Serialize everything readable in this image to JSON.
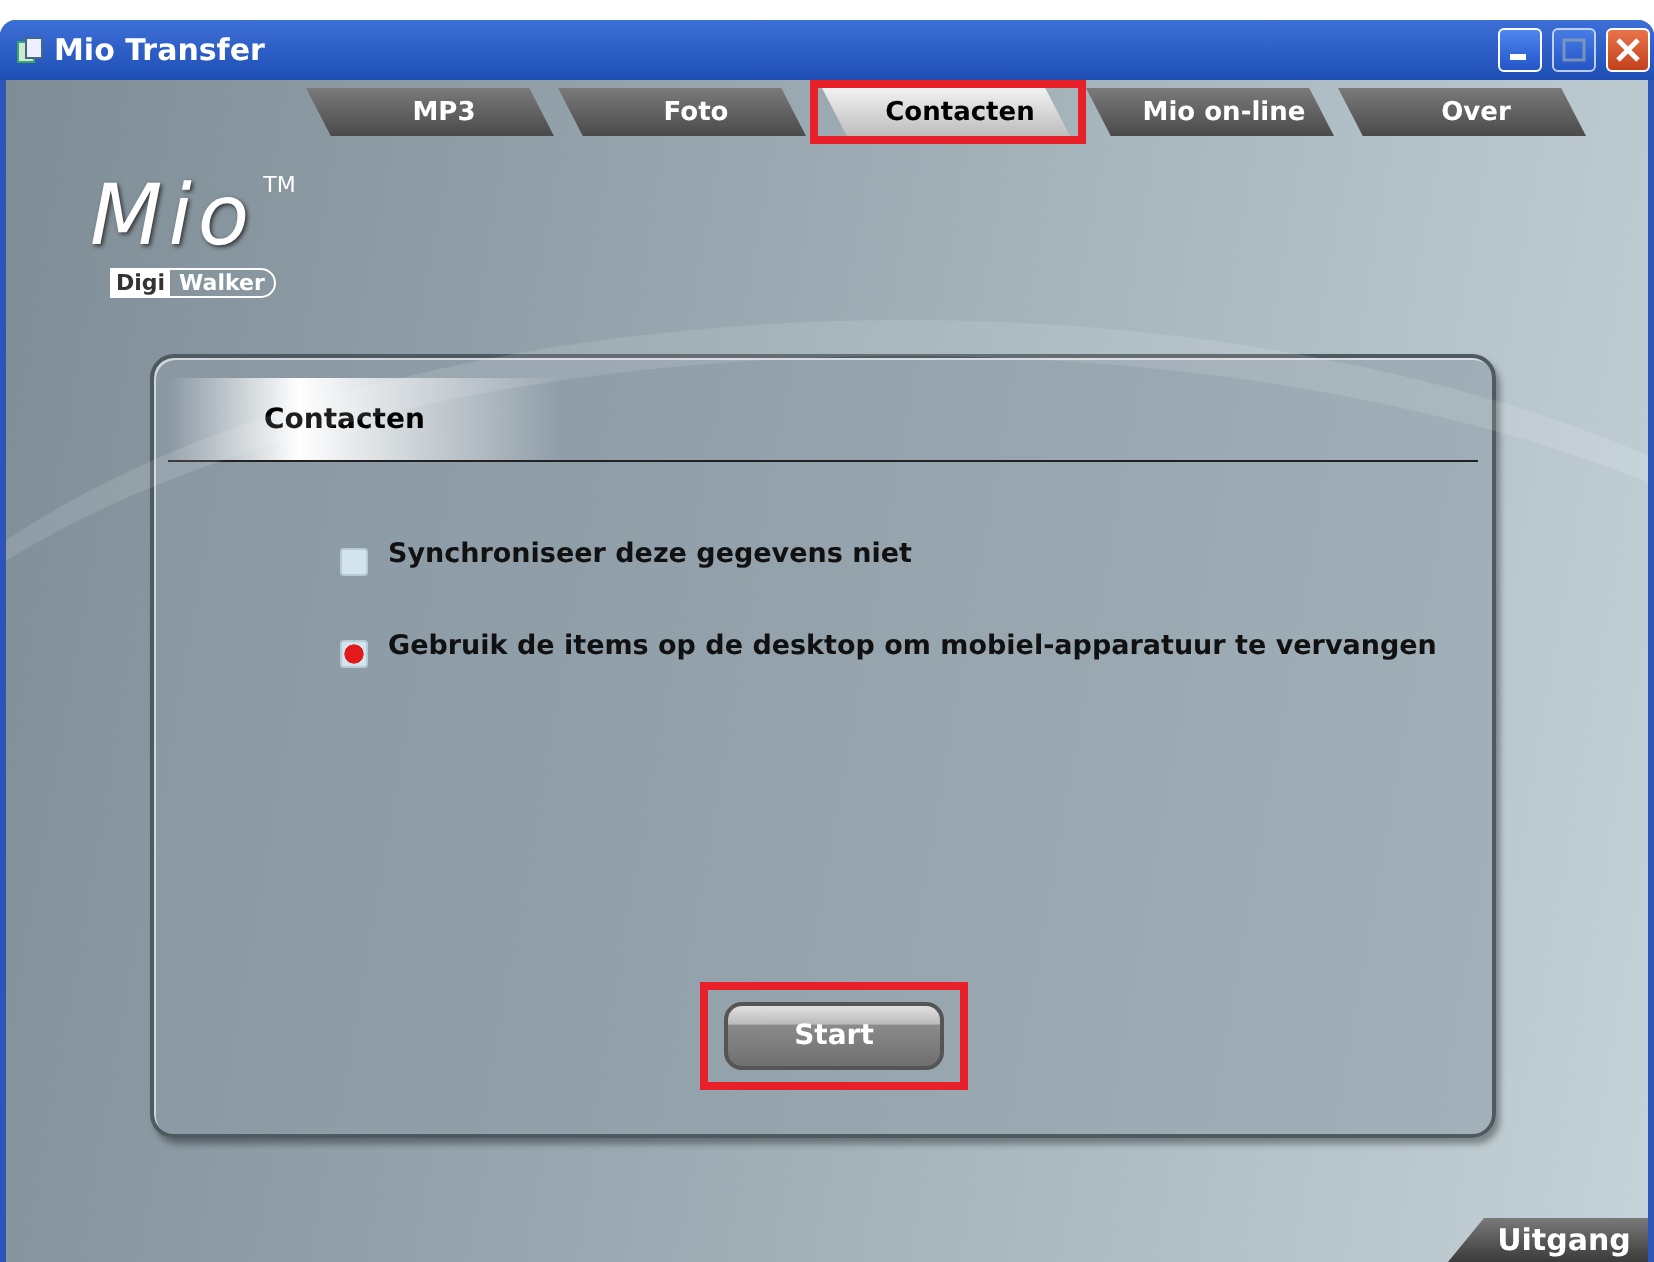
{
  "window": {
    "title": "Mio Transfer"
  },
  "tabs": [
    {
      "label": "MP3",
      "selected": false,
      "highlighted": false
    },
    {
      "label": "Foto",
      "selected": false,
      "highlighted": false
    },
    {
      "label": "Contacten",
      "selected": true,
      "highlighted": true
    },
    {
      "label": "Mio on-line",
      "selected": false,
      "highlighted": false
    },
    {
      "label": "Over",
      "selected": false,
      "highlighted": false
    }
  ],
  "logo": {
    "name": "Mio",
    "trademark": "TM",
    "badge_left": "Digi",
    "badge_right": "Walker"
  },
  "panel": {
    "title": "Contacten",
    "options": [
      {
        "label": "Synchroniseer deze gegevens niet",
        "checked": false
      },
      {
        "label": "Gebruik de items op de desktop om mobiel-apparatuur te vervangen",
        "checked": true
      }
    ],
    "start_button": {
      "label": "Start",
      "highlighted": true
    }
  },
  "exit_tab": {
    "label": "Uitgang"
  }
}
